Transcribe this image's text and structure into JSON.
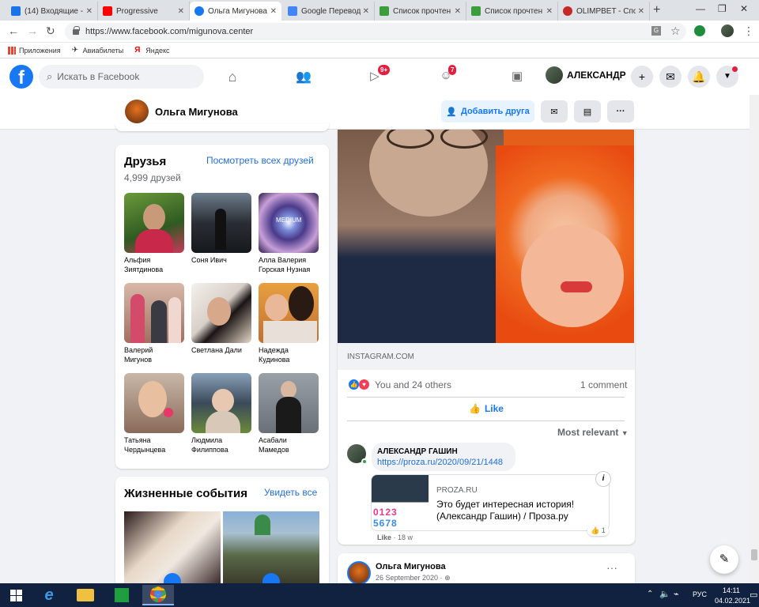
{
  "browser": {
    "tabs": [
      {
        "title": "(14) Входящие - ",
        "color": "#1a73e8"
      },
      {
        "title": "Progressive",
        "color": "#ff0000"
      },
      {
        "title": "Ольга Мигунова",
        "color": "#1877f2"
      },
      {
        "title": "Google Перевод",
        "color": "#4285f4"
      },
      {
        "title": "Список прочтен",
        "color": "#3c9d3c"
      },
      {
        "title": "Список прочтен",
        "color": "#3c9d3c"
      },
      {
        "title": "OLIMPBET - Спо",
        "color": "#c62828"
      }
    ],
    "url": "https://www.facebook.com/migunova.center",
    "bookmarks": [
      "Приложения",
      "Авиабилеты",
      "Яндекс"
    ]
  },
  "facebook": {
    "search_placeholder": "Искать в Facebook",
    "watch_badge": "9+",
    "groups_badge": "7",
    "username": "АЛЕКСАНДР"
  },
  "profile": {
    "name": "Ольга Мигунова",
    "add_friend": "Добавить друга"
  },
  "friends": {
    "title": "Друзья",
    "count": "4,999 друзей",
    "see_all": "Посмотреть всех друзей",
    "list": [
      {
        "line1": "Альфия",
        "line2": "Зиятдинова"
      },
      {
        "line1": "Соня Ивич",
        "line2": ""
      },
      {
        "line1": "Алла Валерия",
        "line2": "Горская Нузная"
      },
      {
        "line1": "Валерий",
        "line2": "Мигунов"
      },
      {
        "line1": "Светлана Дали",
        "line2": ""
      },
      {
        "line1": "Надежда",
        "line2": "Кудинова"
      },
      {
        "line1": "Татьяна",
        "line2": "Чердынцева"
      },
      {
        "line1": "Людмила",
        "line2": "Филиппова"
      },
      {
        "line1": "Асабали",
        "line2": "Мамедов"
      }
    ],
    "medium_label": "MEDIUM"
  },
  "life_events": {
    "title": "Жизненные события",
    "see_all": "Увидеть все"
  },
  "post": {
    "source": "INSTAGRAM.COM",
    "reactions": "You and 24 others",
    "comments": "1 comment",
    "like": "Like",
    "sort": "Most relevant",
    "comment": {
      "author": "АЛЕКСАНДР ГАШИН",
      "link": "https://proza.ru/2020/09/21/1448",
      "card_site": "PROZA.RU",
      "card_title_1": "Это будет интересная история!",
      "card_title_2": "(Александр Гашин) / Проза.ру",
      "card_like_count": "1",
      "like": "Like",
      "time": "· 18 w",
      "info": "i"
    }
  },
  "post2": {
    "author": "Ольга Мигунова",
    "date": "26 September 2020 · "
  },
  "taskbar": {
    "lang": "РУС",
    "time": "14:11",
    "date": "04.02.2021"
  }
}
